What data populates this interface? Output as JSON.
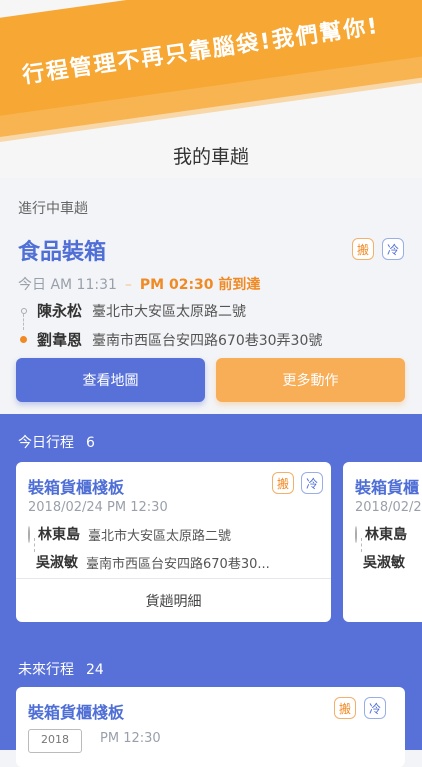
{
  "banner": {
    "text": "行程管理不再只靠腦袋!我們幫你!"
  },
  "page_title": "我的車趟",
  "current": {
    "section_label": "進行中車趟",
    "title": "食品裝箱",
    "badges": [
      "搬",
      "冷"
    ],
    "time_start": "今日 AM 11:31",
    "dash": "–",
    "arrive": "PM 02:30 前到達",
    "from": {
      "name": "陳永松",
      "address": "臺北市大安區太原路二號"
    },
    "to": {
      "name": "劉韋恩",
      "address": "臺南市西區台安四路670巷30弄30號"
    },
    "map_button": "查看地圖",
    "more_button": "更多動作"
  },
  "today": {
    "label": "今日行程",
    "count": "6",
    "cards": [
      {
        "title": "裝箱貨櫃棧板",
        "badges": [
          "搬",
          "冷"
        ],
        "time": "2018/02/24  PM 12:30",
        "from": {
          "name": "林東島",
          "address": "臺北市大安區太原路二號"
        },
        "to": {
          "name": "吳淑敏",
          "address": "臺南市西區台安四路670巷30..."
        },
        "detail": "貨趟明細"
      },
      {
        "title": "裝箱貨櫃",
        "time": "2018/02/2",
        "from": {
          "name": "林東島"
        },
        "to": {
          "name": "吳淑敏"
        }
      }
    ]
  },
  "future": {
    "label": "未來行程",
    "count": "24",
    "card": {
      "title": "裝箱貨櫃棧板",
      "badges": [
        "搬",
        "冷"
      ],
      "date": "2018",
      "time": "PM 12:30"
    }
  },
  "colors": {
    "primary": "#5871d8",
    "accent": "#f8ad57",
    "title_blue": "#4f6fd6",
    "orange": "#f08a24"
  }
}
